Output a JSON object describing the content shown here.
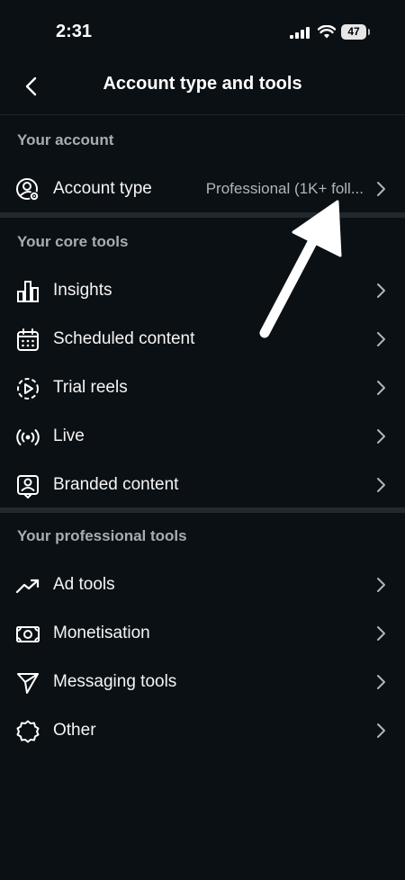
{
  "status_bar": {
    "time": "2:31",
    "battery": "47"
  },
  "header": {
    "title": "Account type and tools"
  },
  "sections": [
    {
      "title": "Your account",
      "items": [
        {
          "label": "Account type",
          "value": "Professional (1K+ foll...",
          "icon": "account-settings-icon"
        }
      ]
    },
    {
      "title": "Your core tools",
      "items": [
        {
          "label": "Insights",
          "icon": "bar-chart-icon"
        },
        {
          "label": "Scheduled content",
          "icon": "calendar-icon"
        },
        {
          "label": "Trial reels",
          "icon": "play-dashed-icon"
        },
        {
          "label": "Live",
          "icon": "broadcast-icon"
        },
        {
          "label": "Branded content",
          "icon": "branded-content-icon"
        }
      ]
    },
    {
      "title": "Your professional tools",
      "items": [
        {
          "label": "Ad tools",
          "icon": "trend-up-icon"
        },
        {
          "label": "Monetisation",
          "icon": "money-icon"
        },
        {
          "label": "Messaging tools",
          "icon": "send-icon"
        },
        {
          "label": "Other",
          "icon": "gear-icon"
        }
      ]
    }
  ],
  "colors": {
    "background": "#0b1014",
    "divider": "#22292e",
    "section_title": "#a7adb2",
    "text": "#f5f5f5"
  }
}
